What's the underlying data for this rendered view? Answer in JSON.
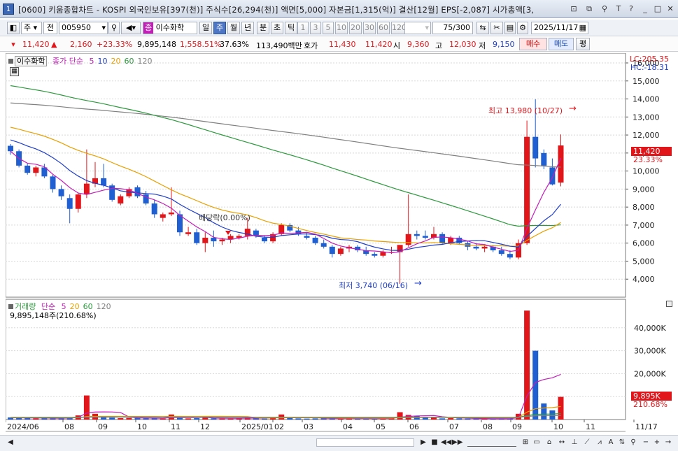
{
  "window": {
    "app_icon": "1",
    "title": "[0600] 키움종합차트 - KOSPI 외국인보유[397(천)] 주식수[26,294(천)] 액면[5,000] 자본금[1,315(억)] 결산[12월] EPS[-2,087] 시가총액[3,",
    "title_buttons": [
      "⊡",
      "⧉",
      "⚲",
      "T",
      "?",
      "_",
      "□",
      "✕"
    ]
  },
  "toolbar": {
    "type_select": "주",
    "market_select": "전",
    "code_input": "005950",
    "stock_badge": "종",
    "stock_name": "이수화학",
    "period_buttons": [
      {
        "label": "일",
        "selected": false
      },
      {
        "label": "주",
        "selected": true
      },
      {
        "label": "월",
        "selected": false
      },
      {
        "label": "년",
        "selected": false
      },
      {
        "label": "분",
        "selected": false
      },
      {
        "label": "초",
        "selected": false
      },
      {
        "label": "틱",
        "selected": false
      }
    ],
    "interval_buttons": [
      "1",
      "3",
      "5",
      "10",
      "20",
      "30",
      "60",
      "120"
    ],
    "count_display": "75/300",
    "date_input": "2025/11/17"
  },
  "quote": {
    "price": "11,420",
    "up_arrow": "▲",
    "change": "2,160",
    "change_rate": "+23.33%",
    "volume": "9,895,148",
    "volume_rate": "1,558.51%",
    "turnover": "37.63%",
    "amount": "113,490백만",
    "hoga_label": "호가",
    "ask": "11,430",
    "bid": "11,420",
    "open_label": "시",
    "open": "9,360",
    "high_label": "고",
    "high": "12,030",
    "low_label": "저",
    "low": "9,150",
    "buy_button": "매수",
    "sell_button": "매도",
    "eval_button": "평"
  },
  "price_panel": {
    "stock_label": "이수화학",
    "ma_label": "종가 단순",
    "ma_periods": [
      {
        "label": "5",
        "color": "#c21fb7"
      },
      {
        "label": "10",
        "color": "#1f3ec9"
      },
      {
        "label": "20",
        "color": "#e8a000"
      },
      {
        "label": "60",
        "color": "#2c9a3c"
      },
      {
        "label": "120",
        "color": "#808080"
      }
    ],
    "lc_label": "LC:205.35",
    "hc_label": "HC:-18.31",
    "current_price_label": "11,420",
    "current_rate_label": "23.33%",
    "high_annotation": "최고 13,980 (10/27)",
    "low_annotation": "최저 3,740 (06/16)",
    "dividend_annotation": "배당락(0.00%)"
  },
  "volume_panel": {
    "label": "거래량",
    "ma_label": "단순",
    "ma_periods": [
      {
        "label": "5",
        "color": "#c21fb7"
      },
      {
        "label": "20",
        "color": "#e8a000"
      },
      {
        "label": "60",
        "color": "#2c9a3c"
      },
      {
        "label": "120",
        "color": "#808080"
      }
    ],
    "value_text": "9,895,148주(210.68%)",
    "current_label": "9,895K",
    "current_rate": "210.68%"
  },
  "colors": {
    "up": "#e0161b",
    "down": "#1f5fd1",
    "ma5": "#c21fb7",
    "ma10": "#1f3ec9",
    "ma20": "#e8a000",
    "ma60": "#2c9a3c",
    "ma120": "#808080"
  },
  "chart_data": {
    "type": "candlestick",
    "price_axis": {
      "min": 3000,
      "max": 16000,
      "ticks": [
        "4,000",
        "5,000",
        "6,000",
        "7,000",
        "8,000",
        "9,000",
        "10,000",
        "11,000",
        "12,000",
        "13,000",
        "14,000",
        "15,000",
        "16,000"
      ]
    },
    "volume_axis": {
      "ticks": [
        "10,000K",
        "20,000K",
        "30,000K",
        "40,000K"
      ]
    },
    "x_labels": [
      "2024/06",
      "08",
      "09",
      "10",
      "11",
      "12",
      "2025/01",
      "02",
      "03",
      "04",
      "05",
      "06",
      "07",
      "08",
      "09",
      "10",
      "11",
      "11/17"
    ],
    "candles": [
      {
        "o": 11400,
        "h": 11500,
        "l": 10900,
        "c": 11100
      },
      {
        "o": 11100,
        "h": 11200,
        "l": 10200,
        "c": 10300
      },
      {
        "o": 10300,
        "h": 10400,
        "l": 9800,
        "c": 9900
      },
      {
        "o": 9900,
        "h": 10300,
        "l": 9700,
        "c": 10200
      },
      {
        "o": 10200,
        "h": 10400,
        "l": 9600,
        "c": 9700
      },
      {
        "o": 9700,
        "h": 9800,
        "l": 8800,
        "c": 9000
      },
      {
        "o": 9000,
        "h": 9200,
        "l": 8400,
        "c": 8600
      },
      {
        "o": 8500,
        "h": 8700,
        "l": 7100,
        "c": 7900
      },
      {
        "o": 7900,
        "h": 8800,
        "l": 7700,
        "c": 8700
      },
      {
        "o": 8700,
        "h": 11200,
        "l": 8500,
        "c": 9300
      },
      {
        "o": 9300,
        "h": 10500,
        "l": 9100,
        "c": 9600
      },
      {
        "o": 9600,
        "h": 10400,
        "l": 9100,
        "c": 9200
      },
      {
        "o": 9200,
        "h": 9300,
        "l": 8300,
        "c": 8400
      },
      {
        "o": 8200,
        "h": 8700,
        "l": 8100,
        "c": 8600
      },
      {
        "o": 8600,
        "h": 9100,
        "l": 8500,
        "c": 9000
      },
      {
        "o": 9100,
        "h": 9200,
        "l": 8500,
        "c": 8600
      },
      {
        "o": 8700,
        "h": 8900,
        "l": 8100,
        "c": 8200
      },
      {
        "o": 8200,
        "h": 8400,
        "l": 7400,
        "c": 7600
      },
      {
        "o": 7400,
        "h": 7700,
        "l": 7200,
        "c": 7600
      },
      {
        "o": 7600,
        "h": 9100,
        "l": 7500,
        "c": 7700
      },
      {
        "o": 7600,
        "h": 7800,
        "l": 6400,
        "c": 6600
      },
      {
        "o": 6500,
        "h": 6900,
        "l": 6400,
        "c": 6600
      },
      {
        "o": 6600,
        "h": 6800,
        "l": 5900,
        "c": 6000
      },
      {
        "o": 6000,
        "h": 6600,
        "l": 5500,
        "c": 6300
      },
      {
        "o": 6300,
        "h": 6700,
        "l": 5800,
        "c": 6100
      },
      {
        "o": 6100,
        "h": 6300,
        "l": 5900,
        "c": 6200
      },
      {
        "o": 6200,
        "h": 6500,
        "l": 6000,
        "c": 6400
      },
      {
        "o": 6300,
        "h": 6500,
        "l": 6200,
        "c": 6400
      },
      {
        "o": 6400,
        "h": 7400,
        "l": 6200,
        "c": 6800
      },
      {
        "o": 6700,
        "h": 6800,
        "l": 6300,
        "c": 6400
      },
      {
        "o": 6300,
        "h": 6400,
        "l": 6000,
        "c": 6100
      },
      {
        "o": 6100,
        "h": 6600,
        "l": 6000,
        "c": 6500
      },
      {
        "o": 6500,
        "h": 7100,
        "l": 6400,
        "c": 7000
      },
      {
        "o": 7000,
        "h": 7100,
        "l": 6600,
        "c": 6700
      },
      {
        "o": 6700,
        "h": 6900,
        "l": 6400,
        "c": 6500
      },
      {
        "o": 6400,
        "h": 6600,
        "l": 6200,
        "c": 6300
      },
      {
        "o": 6300,
        "h": 6400,
        "l": 5900,
        "c": 6000
      },
      {
        "o": 6000,
        "h": 6200,
        "l": 5700,
        "c": 5800
      },
      {
        "o": 5800,
        "h": 5900,
        "l": 5200,
        "c": 5400
      },
      {
        "o": 5400,
        "h": 5800,
        "l": 5300,
        "c": 5700
      },
      {
        "o": 5700,
        "h": 5900,
        "l": 5500,
        "c": 5800
      },
      {
        "o": 5800,
        "h": 5900,
        "l": 5500,
        "c": 5600
      },
      {
        "o": 5600,
        "h": 5800,
        "l": 5300,
        "c": 5400
      },
      {
        "o": 5400,
        "h": 5500,
        "l": 5200,
        "c": 5300
      },
      {
        "o": 5300,
        "h": 5600,
        "l": 5200,
        "c": 5500
      },
      {
        "o": 5500,
        "h": 5800,
        "l": 5400,
        "c": 5500
      },
      {
        "o": 5500,
        "h": 5700,
        "l": 3740,
        "c": 5900
      },
      {
        "o": 5900,
        "h": 8700,
        "l": 5800,
        "c": 6500
      },
      {
        "o": 6500,
        "h": 6700,
        "l": 6200,
        "c": 6400
      },
      {
        "o": 6400,
        "h": 6700,
        "l": 6200,
        "c": 6300
      },
      {
        "o": 6300,
        "h": 6900,
        "l": 6200,
        "c": 6500
      },
      {
        "o": 6500,
        "h": 6600,
        "l": 5900,
        "c": 6000
      },
      {
        "o": 6000,
        "h": 6400,
        "l": 5900,
        "c": 6300
      },
      {
        "o": 6300,
        "h": 6400,
        "l": 5900,
        "c": 6000
      },
      {
        "o": 6000,
        "h": 6100,
        "l": 5600,
        "c": 5800
      },
      {
        "o": 5800,
        "h": 6000,
        "l": 5600,
        "c": 5700
      },
      {
        "o": 5700,
        "h": 5900,
        "l": 5500,
        "c": 5800
      },
      {
        "o": 5800,
        "h": 5900,
        "l": 5500,
        "c": 5600
      },
      {
        "o": 5600,
        "h": 5800,
        "l": 5300,
        "c": 5400
      },
      {
        "o": 5400,
        "h": 5600,
        "l": 5100,
        "c": 5200
      },
      {
        "o": 5200,
        "h": 6200,
        "l": 5100,
        "c": 6000
      },
      {
        "o": 6000,
        "h": 12800,
        "l": 5900,
        "c": 11900
      },
      {
        "o": 11900,
        "h": 13980,
        "l": 10200,
        "c": 10700
      },
      {
        "o": 11000,
        "h": 11200,
        "l": 10100,
        "c": 10300
      },
      {
        "o": 10200,
        "h": 10700,
        "l": 9200,
        "c": 9260
      },
      {
        "o": 9360,
        "h": 12030,
        "l": 9150,
        "c": 11420
      }
    ],
    "volumes": [
      900,
      700,
      600,
      500,
      600,
      500,
      700,
      900,
      1800,
      10500,
      2500,
      900,
      800,
      600,
      700,
      600,
      500,
      600,
      400,
      2200,
      700,
      500,
      600,
      900,
      500,
      400,
      400,
      500,
      1200,
      500,
      400,
      1000,
      2200,
      900,
      500,
      400,
      500,
      500,
      700,
      400,
      500,
      400,
      500,
      400,
      500,
      600,
      3200,
      2000,
      1600,
      800,
      1200,
      500,
      600,
      500,
      400,
      300,
      400,
      300,
      500,
      400,
      2500,
      47500,
      30000,
      7000,
      4000,
      9895
    ]
  }
}
